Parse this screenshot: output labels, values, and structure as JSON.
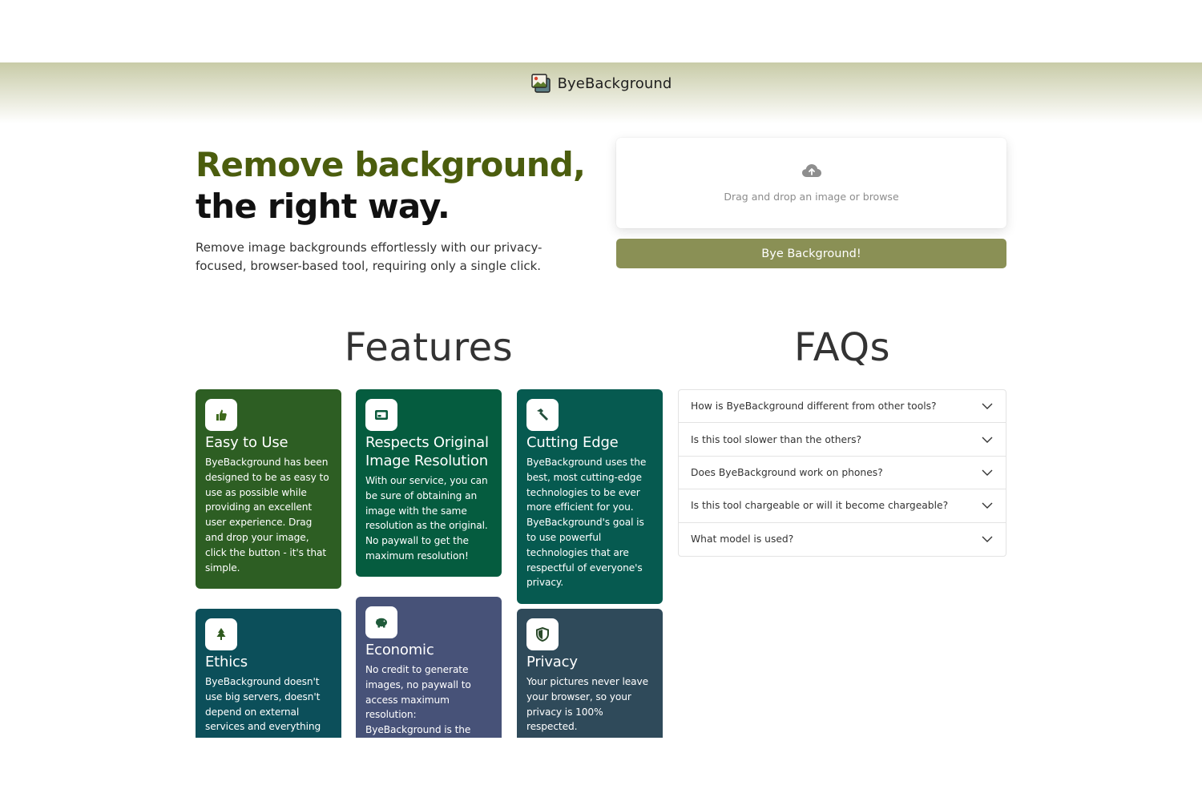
{
  "header": {
    "brand_name": "ByeBackground",
    "brand_icon": "image-icon"
  },
  "hero": {
    "title_line1": "Remove background,",
    "title_line2": "the right way.",
    "subtitle": "Remove image backgrounds effortlessly with our privacy-focused, browser-based tool, requiring only a single click."
  },
  "upload": {
    "icon": "cloud-upload-icon",
    "prompt": "Drag and drop an image or browse",
    "button_label": "Bye Background!"
  },
  "features": {
    "title": "Features",
    "cards": [
      {
        "title": "Easy to Use",
        "icon": "thumbs-up-icon",
        "color": "#2d5e23",
        "body": "ByeBackground has been designed to be as easy to use as possible while providing an excellent user experience. Drag and drop your image, click the button - it's that simple."
      },
      {
        "title": "Respects Original Image Resolution",
        "icon": "image-frame-icon",
        "color": "#055c3f",
        "body": "With our service, you can be sure of obtaining an image with the same resolution as the original. No paywall to get the maximum resolution!"
      },
      {
        "title": "Cutting Edge",
        "icon": "hammer-icon",
        "color": "#065a50",
        "body": "ByeBackground uses the best, most cutting-edge technologies to be ever more efficient for you. ByeBackground's goal is to use powerful technologies that are respectful of everyone's privacy."
      },
      {
        "title": "Ethics",
        "icon": "tree-icon",
        "color": "#0c4f5a",
        "body": "ByeBackground doesn't use big servers, doesn't depend on external services and everything"
      },
      {
        "title": "Economic",
        "icon": "piggy-bank-icon",
        "color": "#475278",
        "body": "No credit to generate images, no paywall to access maximum resolution: ByeBackground is the"
      },
      {
        "title": "Privacy",
        "icon": "shield-icon",
        "color": "#2f4a5a",
        "body": "Your pictures never leave your browser, so your privacy is 100% respected."
      }
    ]
  },
  "faqs": {
    "title": "FAQs",
    "items": [
      {
        "question": "How is ByeBackground different from other tools?"
      },
      {
        "question": "Is this tool slower than the others?"
      },
      {
        "question": "Does ByeBackground work on phones?"
      },
      {
        "question": "Is this tool chargeable or will it become chargeable?"
      },
      {
        "question": "What model is used?"
      }
    ]
  }
}
